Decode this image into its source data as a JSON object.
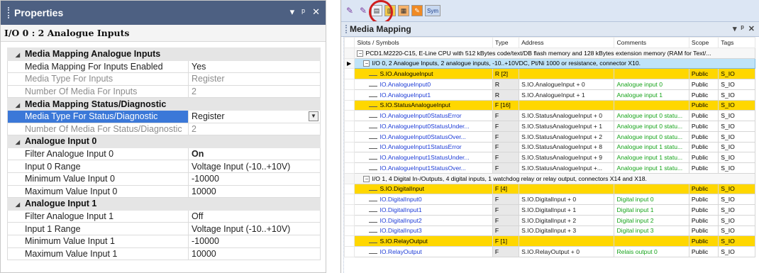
{
  "properties": {
    "title": "Properties",
    "controls": [
      "▾",
      "ᵖ",
      "✕"
    ],
    "object": "I/O 0 : 2 Analogue Inputs",
    "sections": [
      {
        "label": "Media Mapping Analogue Inputs",
        "rows": [
          {
            "name": "Media Mapping For Inputs Enabled",
            "value": "Yes",
            "gray": false
          },
          {
            "name": "Media Type For Inputs",
            "value": "Register",
            "gray": true
          },
          {
            "name": "Number Of Media For Inputs",
            "value": "2",
            "gray": true
          }
        ]
      },
      {
        "label": "Media Mapping Status/Diagnostic",
        "rows": [
          {
            "name": "Media Type For Status/Diagnostic",
            "value": "Register",
            "selected": true
          },
          {
            "name": "Number Of Media For Status/Diagnostic",
            "value": "2",
            "gray": true
          }
        ]
      },
      {
        "label": "Analogue Input 0",
        "rows": [
          {
            "name": "Filter Analogue Input 0",
            "value": "On",
            "bold": true
          },
          {
            "name": "Input 0 Range",
            "value": "Voltage Input (-10..+10V)"
          },
          {
            "name": "Minimum Value Input 0",
            "value": "-10000"
          },
          {
            "name": "Maximum Value Input 0",
            "value": "10000"
          }
        ]
      },
      {
        "label": "Analogue Input 1",
        "rows": [
          {
            "name": "Filter Analogue Input 1",
            "value": "Off"
          },
          {
            "name": "Input 1 Range",
            "value": "Voltage Input (-10..+10V)"
          },
          {
            "name": "Minimum Value Input 1",
            "value": "-10000"
          },
          {
            "name": "Maximum Value Input 1",
            "value": "10000"
          }
        ]
      }
    ]
  },
  "media_mapping": {
    "title": "Media Mapping",
    "controls": [
      "▾",
      "ᵖ",
      "✕"
    ],
    "toolbar_sym_label": "Sym",
    "highlight_color": "#d01f1f",
    "columns": [
      "Slots / Symbols",
      "Type",
      "Address",
      "Comments",
      "Scope",
      "Tags"
    ],
    "device": "PCD1.M2220-C15, E-Line CPU with 512 kBytes code/text/DB flash memory and 128 kBytes extension memory (RAM for Text/...",
    "groups": [
      {
        "label": "I/O 0, 2 Analogue Inputs, 2 analogue inputs, -10..+10VDC, Pt/Ni 1000 or resistance, connector X10.",
        "selected": true,
        "rows": [
          {
            "kind": "symbol",
            "name": "S.IO.AnalogueInput",
            "type": "R [2]",
            "address": "",
            "comment": "",
            "scope": "Public",
            "tags": "S_IO"
          },
          {
            "kind": "item",
            "name": "IO.AnalogueInput0",
            "type": "R",
            "address": "S.IO.AnalogueInput + 0",
            "comment": "Analogue input 0",
            "scope": "Public",
            "tags": "S_IO"
          },
          {
            "kind": "item",
            "name": "IO.AnalogueInput1",
            "type": "R",
            "address": "S.IO.AnalogueInput + 1",
            "comment": "Analogue input 1",
            "scope": "Public",
            "tags": "S_IO"
          },
          {
            "kind": "symbol",
            "name": "S.IO.StatusAnalogueInput",
            "type": "F [16]",
            "address": "",
            "comment": "",
            "scope": "Public",
            "tags": "S_IO"
          },
          {
            "kind": "item",
            "name": "IO.AnalogueInput0StatusError",
            "type": "F",
            "address": "S.IO.StatusAnalogueInput + 0",
            "comment": "Analogue input 0 statu...",
            "scope": "Public",
            "tags": "S_IO"
          },
          {
            "kind": "item",
            "name": "IO.AnalogueInput0StatusUnder...",
            "type": "F",
            "address": "S.IO.StatusAnalogueInput + 1",
            "comment": "Analogue input 0 statu...",
            "scope": "Public",
            "tags": "S_IO"
          },
          {
            "kind": "item",
            "name": "IO.AnalogueInput0StatusOver...",
            "type": "F",
            "address": "S.IO.StatusAnalogueInput + 2",
            "comment": "Analogue input 0 statu...",
            "scope": "Public",
            "tags": "S_IO"
          },
          {
            "kind": "item",
            "name": "IO.AnalogueInput1StatusError",
            "type": "F",
            "address": "S.IO.StatusAnalogueInput + 8",
            "comment": "Analogue input 1 statu...",
            "scope": "Public",
            "tags": "S_IO"
          },
          {
            "kind": "item",
            "name": "IO.AnalogueInput1StatusUnder...",
            "type": "F",
            "address": "S.IO.StatusAnalogueInput + 9",
            "comment": "Analogue input 1 statu...",
            "scope": "Public",
            "tags": "S_IO"
          },
          {
            "kind": "item",
            "name": "IO.AnalogueInput1StatusOver...",
            "type": "F",
            "address": "S.IO.StatusAnalogueInput +...",
            "comment": "Analogue input 1 statu...",
            "scope": "Public",
            "tags": "S_IO"
          }
        ]
      },
      {
        "label": "I/O 1, 4 Digital In-/Outputs, 4 digital inputs, 1 watchdog relay or relay output, connectors X14 and X18.",
        "selected": false,
        "rows": [
          {
            "kind": "symbol",
            "name": "S.IO.DigitalInput",
            "type": "F [4]",
            "address": "",
            "comment": "",
            "scope": "Public",
            "tags": "S_IO"
          },
          {
            "kind": "item",
            "name": "IO.DigitalInput0",
            "type": "F",
            "address": "S.IO.DigitalInput + 0",
            "comment": "Digital input 0",
            "scope": "Public",
            "tags": "S_IO"
          },
          {
            "kind": "item",
            "name": "IO.DigitalInput1",
            "type": "F",
            "address": "S.IO.DigitalInput + 1",
            "comment": "Digital input 1",
            "scope": "Public",
            "tags": "S_IO"
          },
          {
            "kind": "item",
            "name": "IO.DigitalInput2",
            "type": "F",
            "address": "S.IO.DigitalInput + 2",
            "comment": "Digital input 2",
            "scope": "Public",
            "tags": "S_IO"
          },
          {
            "kind": "item",
            "name": "IO.DigitalInput3",
            "type": "F",
            "address": "S.IO.DigitalInput + 3",
            "comment": "Digital input 3",
            "scope": "Public",
            "tags": "S_IO"
          },
          {
            "kind": "symbol",
            "name": "S.IO.RelayOutput",
            "type": "F [1]",
            "address": "",
            "comment": "",
            "scope": "Public",
            "tags": "S_IO"
          },
          {
            "kind": "item",
            "name": "IO.RelayOutput",
            "type": "F",
            "address": "S.IO.RelayOutput + 0",
            "comment": "Relais output 0",
            "scope": "Public",
            "tags": "S_IO"
          }
        ]
      }
    ]
  }
}
